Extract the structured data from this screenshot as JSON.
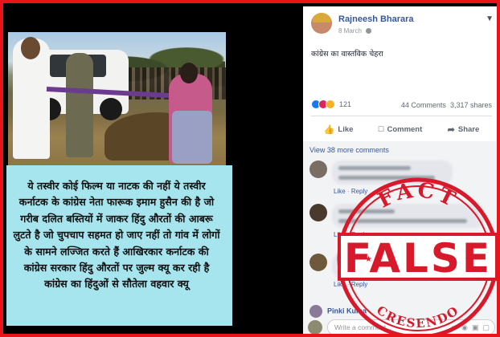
{
  "post_image": {
    "caption": "ये तस्वीर कोई फिल्म या नाटक की नहीं ये तस्वीर कर्नाटक के कांग्रेस नेता फारूक इमाम हुसैन की है जो गरीब दलित बस्तियों में जाकर हिंदु औरतों की आबरू लुटते है जो चुपचाप सहमत हो जाए नहीं तो गांव में लोगों के सामने लज्जित करते हैं आखिरकार कर्नाटक की कांग्रेस सरकार हिंदु औरतों पर जुल्म क्यू कर रही है कांग्रेस का हिंदुओं से सौतेला वहवार क्यू"
  },
  "post": {
    "author": "Rajneesh Bharara",
    "date": "8 March",
    "text": "कांग्रेस का वास्तविक चेहरा",
    "reaction_count": "121",
    "comments_count": "44 Comments",
    "shares_count": "3,317 shares",
    "actions": {
      "like": "Like",
      "comment": "Comment",
      "share": "Share"
    },
    "view_more": "View 38 more comments",
    "comment_meta": {
      "like": "Like",
      "reply": "Reply"
    },
    "partial_commenter": "Pinki Kuma",
    "write_placeholder": "Write a comment..."
  },
  "stamp": {
    "top": "FACT",
    "main": "FALSE",
    "bottom": "CRESENDO"
  },
  "colors": {
    "frame": "#e8141a",
    "fb_link": "#365899",
    "stamp_red": "#d8192b",
    "caption_bg": "#a6e4ee"
  },
  "icons": [
    "chevron-down-icon",
    "globe-icon",
    "like-icon",
    "comment-icon",
    "share-icon",
    "camera-icon",
    "gif-icon",
    "sticker-icon",
    "emoji-icon"
  ]
}
